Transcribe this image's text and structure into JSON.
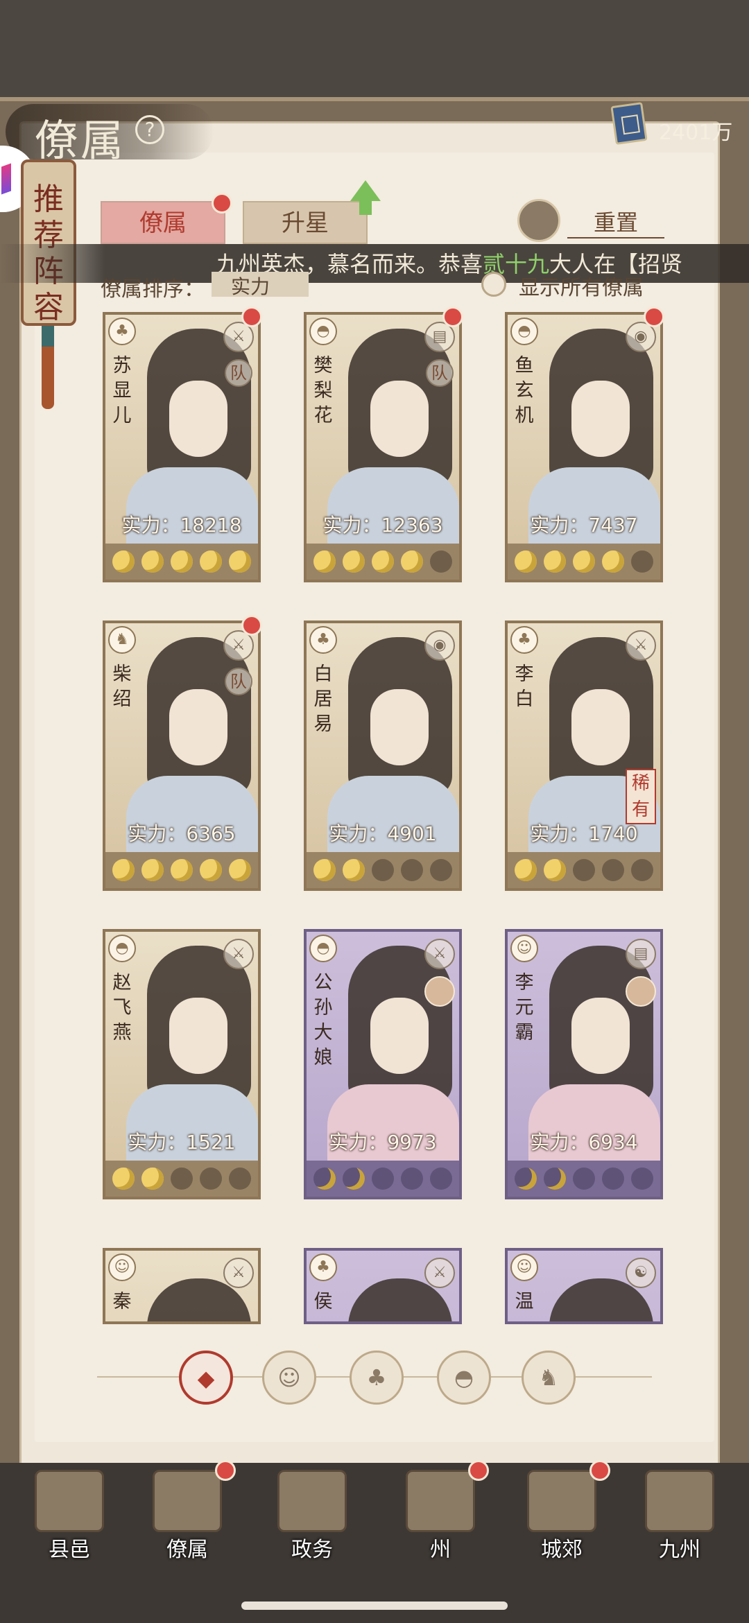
{
  "header": {
    "title": "僚属",
    "currency_value": "2401万"
  },
  "scroll_tab": {
    "label": "推荐阵容"
  },
  "tabs": [
    {
      "label": "僚属",
      "active": true
    },
    {
      "label": "升星",
      "active": false
    }
  ],
  "reset_label": "重置",
  "marquee": {
    "prefix": "九州英杰，慕名而来。恭喜",
    "highlight": "贰十九",
    "suffix": "大人在【招贤"
  },
  "sort": {
    "label": "僚属排序：",
    "value": "实力"
  },
  "show_all_label": "显示所有僚属",
  "cards": [
    {
      "name": "苏显儿",
      "power": "实力：18218",
      "stars": 5,
      "team": "队",
      "dot": true,
      "rarity": "normal",
      "type_icon": "calabash-icon",
      "weapon_icon": "sword-icon"
    },
    {
      "name": "樊梨花",
      "power": "实力：12363",
      "stars": 4,
      "team": "队",
      "dot": true,
      "rarity": "normal",
      "type_icon": "fan-icon",
      "weapon_icon": "book-icon"
    },
    {
      "name": "鱼玄机",
      "power": "实力：7437",
      "stars": 4,
      "team": "",
      "dot": true,
      "rarity": "normal",
      "type_icon": "fan-icon",
      "weapon_icon": "drum-icon"
    },
    {
      "name": "柴绍",
      "power": "实力：6365",
      "stars": 5,
      "team": "队",
      "dot": true,
      "rarity": "normal",
      "type_icon": "dragon-icon",
      "weapon_icon": "sword-icon"
    },
    {
      "name": "白居易",
      "power": "实力：4901",
      "stars": 2,
      "team": "",
      "dot": false,
      "rarity": "normal",
      "type_icon": "calabash-icon",
      "weapon_icon": "drum-icon"
    },
    {
      "name": "李白",
      "power": "实力：1740",
      "stars": 2,
      "team": "",
      "dot": false,
      "rarity": "rare",
      "rare_label": "稀有",
      "type_icon": "calabash-icon",
      "weapon_icon": "sword-icon"
    },
    {
      "name": "赵飞燕",
      "power": "实力：1521",
      "stars": 2,
      "team": "",
      "dot": false,
      "rarity": "normal",
      "type_icon": "fan-icon",
      "weapon_icon": "sword-icon"
    },
    {
      "name": "公孙大娘",
      "power": "实力：9973",
      "stars": 2,
      "team": "",
      "dot": false,
      "rarity": "epic",
      "type_icon": "fan-icon",
      "weapon_icon": "sword-icon"
    },
    {
      "name": "李元霸",
      "power": "实力：6934",
      "stars": 2,
      "team": "",
      "dot": false,
      "rarity": "epic",
      "type_icon": "mask-icon",
      "weapon_icon": "book-icon"
    }
  ],
  "partial_cards": [
    {
      "name": "秦",
      "rarity": "normal",
      "type_icon": "mask-icon",
      "weapon_icon": "sword-icon"
    },
    {
      "name": "侯",
      "rarity": "epic",
      "type_icon": "calabash-icon",
      "weapon_icon": "sword-icon"
    },
    {
      "name": "温",
      "rarity": "epic",
      "type_icon": "mask-icon",
      "weapon_icon": "yinyang-icon"
    }
  ],
  "filters": [
    {
      "icon": "all-diamond-icon",
      "active": true
    },
    {
      "icon": "mask-icon",
      "active": false
    },
    {
      "icon": "calabash-icon",
      "active": false
    },
    {
      "icon": "fan-icon",
      "active": false
    },
    {
      "icon": "dragon-icon",
      "active": false
    }
  ],
  "bottom_nav": [
    {
      "label": "县邑",
      "dot": false
    },
    {
      "label": "僚属",
      "dot": true
    },
    {
      "label": "政务",
      "dot": false
    },
    {
      "label": "州",
      "dot": true
    },
    {
      "label": "城郊",
      "dot": true
    },
    {
      "label": "九州",
      "dot": false
    }
  ],
  "colors": {
    "accent_red": "#b03a2e",
    "notification_dot": "#d94a44",
    "highlight_green": "#8fd16a",
    "paper": "#efe7da"
  }
}
